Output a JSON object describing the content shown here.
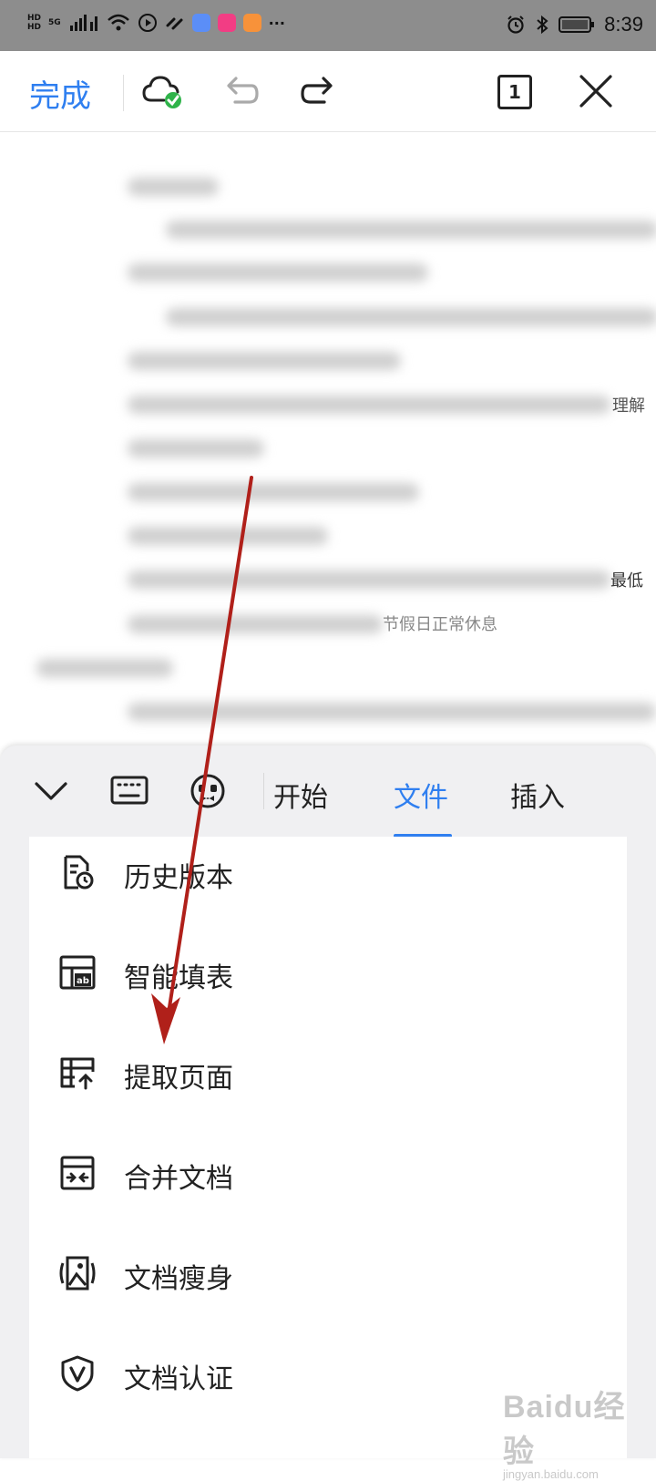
{
  "status_bar": {
    "left_labels": [
      "HD",
      "5G",
      "HD"
    ],
    "time": "8:39",
    "more": "···"
  },
  "toolbar": {
    "done_label": "完成",
    "page_count": "1"
  },
  "document": {
    "visible_fragments": [
      "理解",
      "最低",
      "节假日正常休息"
    ]
  },
  "tabs": {
    "items": [
      "开始",
      "文件",
      "插入"
    ],
    "active": "文件"
  },
  "menu": {
    "items": [
      {
        "label": "历史版本",
        "icon": "history-version-icon"
      },
      {
        "label": "智能填表",
        "icon": "smart-form-icon"
      },
      {
        "label": "提取页面",
        "icon": "extract-pages-icon"
      },
      {
        "label": "合并文档",
        "icon": "merge-documents-icon"
      },
      {
        "label": "文档瘦身",
        "icon": "compress-document-icon"
      },
      {
        "label": "文档认证",
        "icon": "document-verify-icon"
      }
    ]
  },
  "watermark": {
    "logo": "Baidu经验",
    "sub": "jingyan.baidu.com"
  },
  "colors": {
    "accent": "#2f7ff0",
    "arrow": "#b0201a",
    "status_bar": "#8d8d8d",
    "cloud_check": "#2fb34a"
  }
}
